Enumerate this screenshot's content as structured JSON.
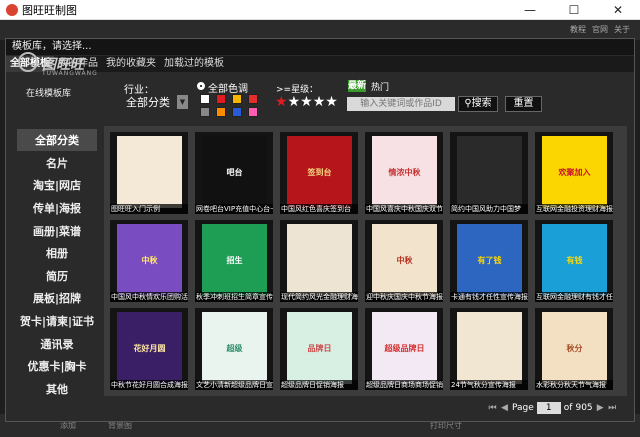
{
  "app": {
    "title": "图旺旺制图"
  },
  "bg_toolbar": {
    "links": [
      "教程",
      "官网",
      "关于"
    ]
  },
  "bg_bottom": {
    "left_text": "添加",
    "mid_text": "背景图",
    "right_text": "打印尺寸"
  },
  "dialog": {
    "title": "模板库，请选择...",
    "tabs": [
      "全部模板",
      "我的作品",
      "我的收藏夹",
      "加载过的模板"
    ],
    "logo": {
      "name": "图旺旺",
      "sub": "TUWANGWANG",
      "caption": "在线模板库"
    },
    "filters": {
      "industry_label": "行业：",
      "industry_value": "全部分类",
      "color_label": "全部色调",
      "star_label": ">=星级：",
      "stars": "★★★★★",
      "badge_new": "最新",
      "hot_label": "热门",
      "search_placeholder": "输入关键词或作品ID",
      "search_button": "搜索",
      "reset_button": "重置",
      "swatches": [
        "#ffffff",
        "#e11b22",
        "#f5b700",
        "#e32e2e",
        "#888888",
        "#ff8c00",
        "#2a5bd7",
        "#ff5db1",
        "#1fa03c",
        "#00a6ad",
        "#ff66c4",
        "#b34be0"
      ]
    },
    "sidebar": [
      "全部分类",
      "名片",
      "淘宝|网店",
      "传单|海报",
      "画册|菜谱",
      "相册",
      "简历",
      "展板|招牌",
      "贺卡|请柬|证书",
      "通讯录",
      "优惠卡|胸卡",
      "其他"
    ],
    "templates": [
      {
        "caption": "图旺旺入门示例",
        "bg": "#f4e9d6",
        "fg": "#333",
        "text": ""
      },
      {
        "caption": "网卷吧台VIP充值中心台卡",
        "bg": "#111111",
        "fg": "#fff",
        "text": "吧台"
      },
      {
        "caption": "中国风红色喜庆签到台",
        "bg": "#b5151b",
        "fg": "#f5d37c",
        "text": "签到台"
      },
      {
        "caption": "中国风喜庆中秋国庆双节",
        "bg": "#f7e1e4",
        "fg": "#c8302f",
        "text": "情浓中秋"
      },
      {
        "caption": "简约中国风助力中国梦",
        "bg": "#2a2a2a",
        "fg": "#fff",
        "text": ""
      },
      {
        "caption": "互联网金融投资理财海报",
        "bg": "#fbd600",
        "fg": "#c8102e",
        "text": "欢聚加入"
      },
      {
        "caption": "中国风中秋情欢乐团购活",
        "bg": "#7a4cc2",
        "fg": "#ffe86a",
        "text": "中秋"
      },
      {
        "caption": "秋季冲刺班招生简章宣传",
        "bg": "#1e9e55",
        "fg": "#fff",
        "text": "招生"
      },
      {
        "caption": "现代简约风光金融理财海",
        "bg": "#ede4d3",
        "fg": "#555",
        "text": ""
      },
      {
        "caption": "迎中秋庆国庆中秋节海报",
        "bg": "#f2e3cc",
        "fg": "#b8321f",
        "text": "中秋"
      },
      {
        "caption": "卡通有钱才任性宣传海报",
        "bg": "#2d66c1",
        "fg": "#ffd800",
        "text": "有了钱"
      },
      {
        "caption": "互联网金融理财有钱才任性",
        "bg": "#1aa0d6",
        "fg": "#ffd800",
        "text": "有钱"
      },
      {
        "caption": "中秋节花好月圆合成海报",
        "bg": "#3a1f67",
        "fg": "#ffe8a3",
        "text": "花好月圆"
      },
      {
        "caption": "文艺小清新超级品牌日宣",
        "bg": "#e9f4ef",
        "fg": "#2f8d6a",
        "text": "超级"
      },
      {
        "caption": "超级品牌日促销海报",
        "bg": "#d8f0e3",
        "fg": "#c94a4a",
        "text": "品牌日"
      },
      {
        "caption": "超级品牌日商场商场促销",
        "bg": "#f3e9f4",
        "fg": "#d3302f",
        "text": "超级品牌日"
      },
      {
        "caption": "24节气秋分宣传海报",
        "bg": "#f1e6d2",
        "fg": "#8a5a2a",
        "text": ""
      },
      {
        "caption": "水彩秋分秋天节气海报",
        "bg": "#f3e0c3",
        "fg": "#a54f24",
        "text": "秋分"
      }
    ],
    "pager": {
      "label": "Page",
      "current": "1",
      "of_label": "of",
      "total": "905"
    }
  }
}
